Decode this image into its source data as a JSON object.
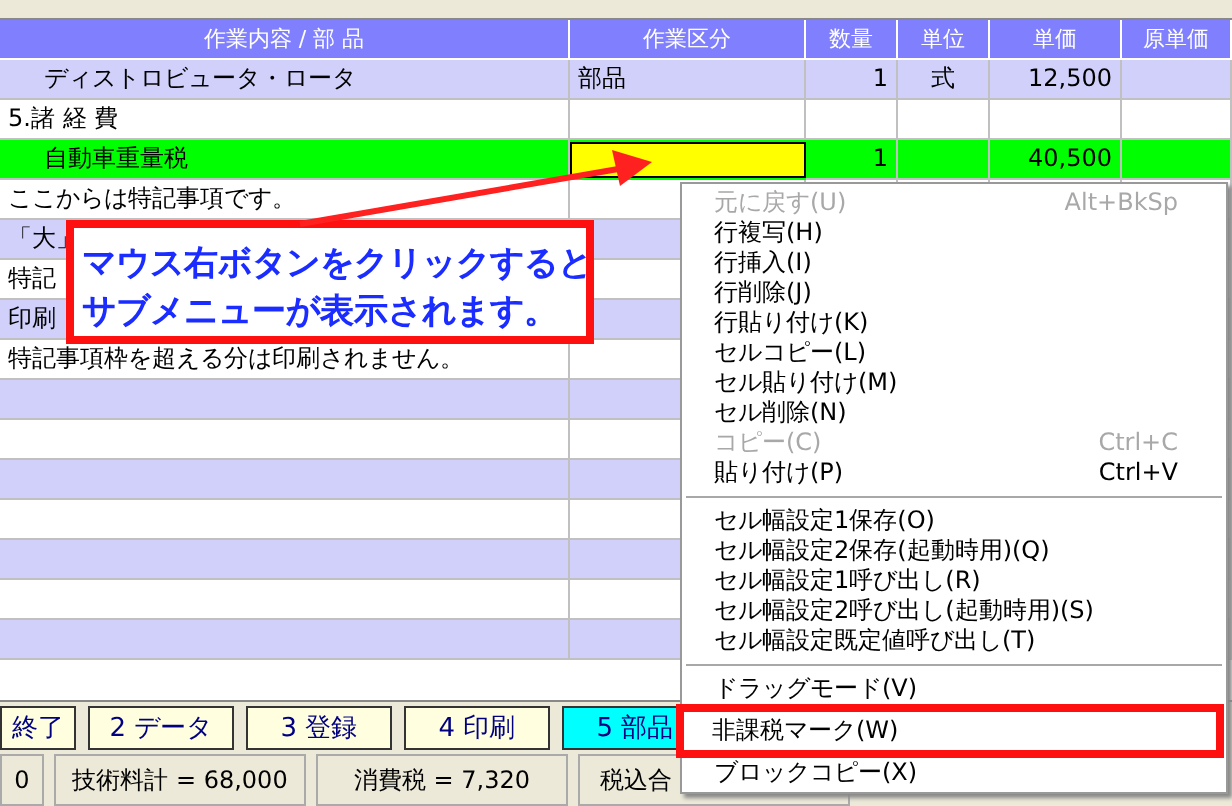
{
  "table": {
    "columns": [
      "作業内容 / 部 品",
      "作業区分",
      "数量",
      "単位",
      "単価",
      "原単価"
    ],
    "rows": [
      {
        "kind": "item",
        "selected": false,
        "cells": [
          "ディストロビュータ・ロータ",
          "部品",
          "1",
          "式",
          "12,500",
          ""
        ]
      },
      {
        "kind": "section",
        "selected": false,
        "cells": [
          "5.諸 経 費",
          "",
          "",
          "",
          "",
          ""
        ]
      },
      {
        "kind": "item",
        "selected": true,
        "cells": [
          "自動車重量税",
          "",
          "1",
          "",
          "40,500",
          ""
        ]
      },
      {
        "kind": "note",
        "selected": false,
        "cells": [
          "ここからは特記事項です。",
          "",
          "",
          "",
          "",
          ""
        ]
      },
      {
        "kind": "note",
        "selected": false,
        "cells": [
          "「大」",
          "",
          "",
          "",
          "",
          ""
        ]
      },
      {
        "kind": "note",
        "selected": false,
        "cells": [
          "特記",
          "",
          "",
          "",
          "",
          ""
        ]
      },
      {
        "kind": "note",
        "selected": false,
        "cells": [
          "印刷",
          "",
          "",
          "",
          "",
          ""
        ]
      },
      {
        "kind": "note",
        "selected": false,
        "cells": [
          "特記事項枠を超える分は印刷されません。",
          "",
          "",
          "",
          "",
          ""
        ]
      }
    ]
  },
  "callout": {
    "lines": [
      "マウス右ボタンをクリックすると",
      "サブメニューが表示されます。"
    ]
  },
  "context_menu": {
    "items": [
      {
        "kind": "item",
        "label": "元に戻す(U)",
        "shortcut": "Alt+BkSp",
        "disabled": true,
        "highlighted": false
      },
      {
        "kind": "item",
        "label": "行複写(H)",
        "disabled": false,
        "highlighted": false
      },
      {
        "kind": "item",
        "label": "行挿入(I)",
        "disabled": false,
        "highlighted": false
      },
      {
        "kind": "item",
        "label": "行削除(J)",
        "disabled": false,
        "highlighted": false
      },
      {
        "kind": "item",
        "label": "行貼り付け(K)",
        "disabled": false,
        "highlighted": false
      },
      {
        "kind": "item",
        "label": "セルコピー(L)",
        "disabled": false,
        "highlighted": false
      },
      {
        "kind": "item",
        "label": "セル貼り付け(M)",
        "disabled": false,
        "highlighted": false
      },
      {
        "kind": "item",
        "label": "セル削除(N)",
        "disabled": false,
        "highlighted": false
      },
      {
        "kind": "item",
        "label": "コピー(C)",
        "shortcut": "Ctrl+C",
        "disabled": true,
        "highlighted": false
      },
      {
        "kind": "item",
        "label": "貼り付け(P)",
        "shortcut": "Ctrl+V",
        "disabled": false,
        "highlighted": false
      },
      {
        "kind": "separator"
      },
      {
        "kind": "item",
        "label": "セル幅設定1保存(O)",
        "disabled": false,
        "highlighted": false
      },
      {
        "kind": "item",
        "label": "セル幅設定2保存(起動時用)(Q)",
        "disabled": false,
        "highlighted": false
      },
      {
        "kind": "item",
        "label": "セル幅設定1呼び出し(R)",
        "disabled": false,
        "highlighted": false
      },
      {
        "kind": "item",
        "label": "セル幅設定2呼び出し(起動時用)(S)",
        "disabled": false,
        "highlighted": false
      },
      {
        "kind": "item",
        "label": "セル幅設定既定値呼び出し(T)",
        "disabled": false,
        "highlighted": false
      },
      {
        "kind": "separator"
      },
      {
        "kind": "item",
        "label": "ドラッグモード(V)",
        "disabled": false,
        "highlighted": false
      },
      {
        "kind": "item",
        "label": "非課税マーク(W)",
        "disabled": false,
        "highlighted": true
      },
      {
        "kind": "item",
        "label": "ブロックコピー(X)",
        "disabled": false,
        "highlighted": false
      }
    ]
  },
  "function_keys": [
    {
      "label": "終了",
      "selected": false
    },
    {
      "label": "2 データ",
      "selected": false
    },
    {
      "label": "3 登録",
      "selected": false
    },
    {
      "label": "4 印刷",
      "selected": false
    },
    {
      "label": "5 部品",
      "selected": true
    }
  ],
  "status_bar": [
    "0",
    "技術料計 = 68,000",
    "消費税 = 7,320",
    "税込合"
  ]
}
